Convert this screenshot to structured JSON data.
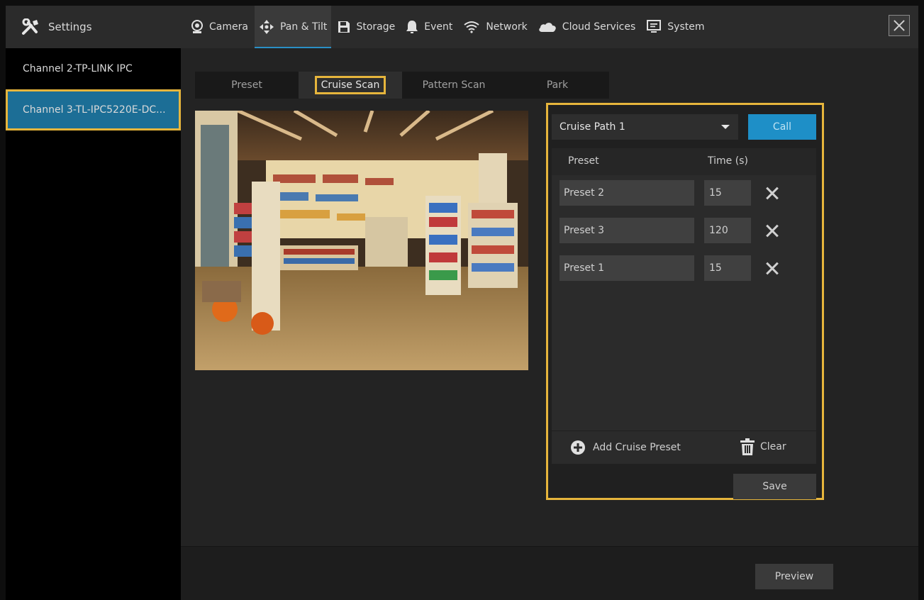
{
  "header": {
    "settings_label": "Settings",
    "tabs": [
      {
        "label": "Camera",
        "icon": "camera-icon"
      },
      {
        "label": "Pan & Tilt",
        "icon": "pan-tilt-icon"
      },
      {
        "label": "Storage",
        "icon": "storage-icon"
      },
      {
        "label": "Event",
        "icon": "bell-icon"
      },
      {
        "label": "Network",
        "icon": "wifi-icon"
      },
      {
        "label": "Cloud Services",
        "icon": "cloud-icon"
      },
      {
        "label": "System",
        "icon": "monitor-icon"
      }
    ],
    "active_tab": "Pan & Tilt"
  },
  "sidebar": {
    "items": [
      {
        "label": "Channel 2-TP-LINK IPC"
      },
      {
        "label": "Channel 3-TL-IPC5220E-DC..."
      }
    ],
    "active_index": 1
  },
  "subtabs": {
    "items": [
      "Preset",
      "Cruise Scan",
      "Pattern Scan",
      "Park"
    ],
    "active": "Cruise Scan"
  },
  "cruise": {
    "path_selected": "Cruise Path 1",
    "call_label": "Call",
    "column_preset": "Preset",
    "column_time": "Time (s)",
    "rows": [
      {
        "preset": "Preset 2",
        "time": "15"
      },
      {
        "preset": "Preset 3",
        "time": "120"
      },
      {
        "preset": "Preset 1",
        "time": "15"
      }
    ],
    "add_label": "Add Cruise Preset",
    "clear_label": "Clear",
    "save_label": "Save"
  },
  "footer": {
    "preview_label": "Preview"
  },
  "colors": {
    "accent_blue": "#1e8fc7",
    "highlight_yellow": "#e6b53c"
  }
}
